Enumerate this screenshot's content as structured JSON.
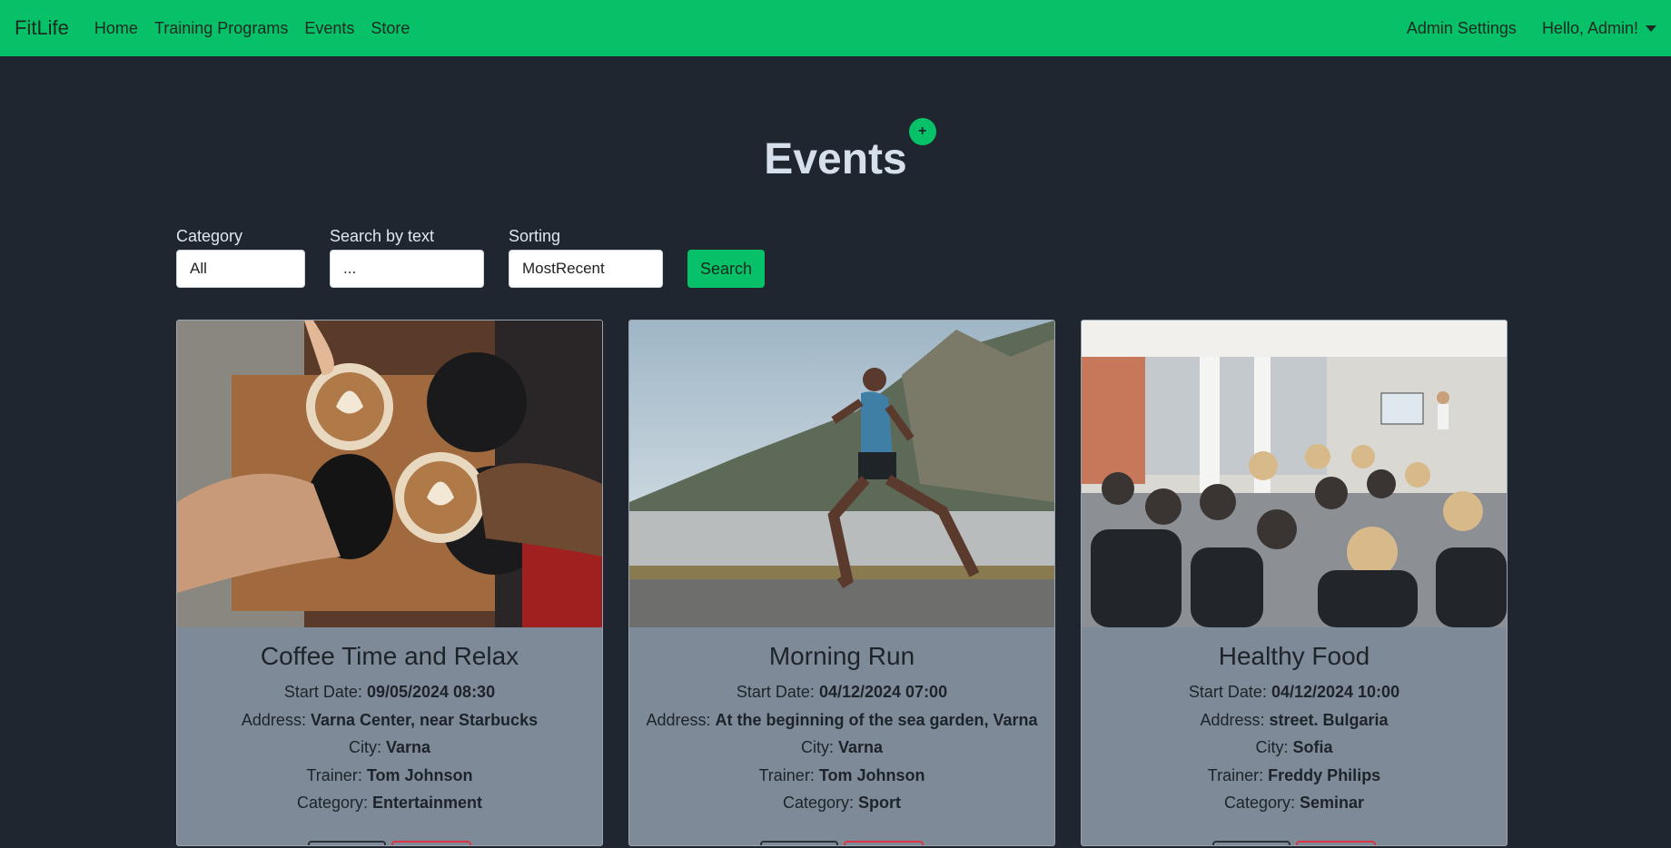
{
  "navbar": {
    "brand": "FitLife",
    "links": [
      "Home",
      "Training Programs",
      "Events",
      "Store"
    ],
    "admin_settings": "Admin Settings",
    "user_greeting": "Hello, Admin!"
  },
  "page": {
    "title": "Events",
    "add_button": "+"
  },
  "filters": {
    "category": {
      "label": "Category",
      "value": "All"
    },
    "search": {
      "label": "Search by text",
      "value": "..."
    },
    "sorting": {
      "label": "Sorting",
      "value": "MostRecent"
    },
    "search_button": "Search"
  },
  "labels": {
    "start_date": "Start Date:",
    "address": "Address:",
    "city": "City:",
    "trainer": "Trainer:",
    "category": "Category:"
  },
  "events": [
    {
      "title": "Coffee Time and Relax",
      "start_date": "09/05/2024 08:30",
      "address": "Varna Center, near Starbucks",
      "city": "Varna",
      "trainer": "Tom Johnson",
      "category": "Entertainment"
    },
    {
      "title": "Morning Run",
      "start_date": "04/12/2024 07:00",
      "address": "At the beginning of the sea garden, Varna",
      "city": "Varna",
      "trainer": "Tom Johnson",
      "category": "Sport"
    },
    {
      "title": "Healthy Food",
      "start_date": "04/12/2024 10:00",
      "address": "street. Bulgaria",
      "city": "Sofia",
      "trainer": "Freddy Philips",
      "category": "Seminar"
    }
  ],
  "colors": {
    "brand_green": "#06c167",
    "background": "#1f2630",
    "card_body": "#7e8a97",
    "danger": "#dc3545"
  }
}
